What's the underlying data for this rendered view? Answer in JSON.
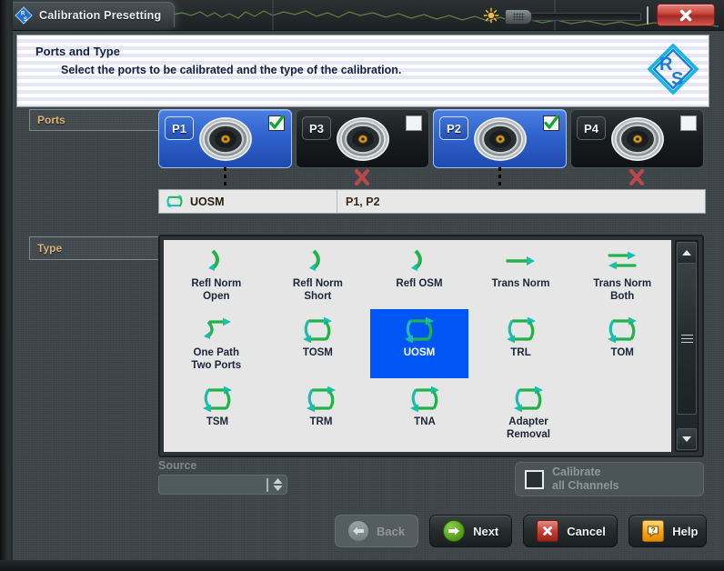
{
  "titlebar": {
    "tab_title": "Calibration Presetting",
    "logo_icon": "rohde-schwarz-logo-icon",
    "brightness_icon": "sun-brightness-icon",
    "slider_value": 0,
    "close_label": "X",
    "close_icon": "close-icon"
  },
  "header": {
    "title": "Ports and Type",
    "subtitle": "Select the ports to be calibrated and the type of the calibration.",
    "logo_icon": "rs-diamond-logo-icon",
    "logo_letters": [
      "R",
      "S"
    ]
  },
  "ports": {
    "label": "Ports",
    "items": [
      {
        "name": "P1",
        "selected": true,
        "checked": true,
        "marker": "dots"
      },
      {
        "name": "P3",
        "selected": false,
        "checked": false,
        "marker": "cross"
      },
      {
        "name": "P2",
        "selected": true,
        "checked": true,
        "marker": "dots"
      },
      {
        "name": "P4",
        "selected": false,
        "checked": false,
        "marker": "cross"
      }
    ]
  },
  "summary": {
    "icon": "uosm-loop-icon",
    "cal_type": "UOSM",
    "cal_ports": "P1, P2"
  },
  "type": {
    "label": "Type",
    "selected": "UOSM",
    "rows": [
      [
        {
          "label": "Refl Norm\nOpen",
          "icon": "reflection-arrow-icon",
          "selected": false
        },
        {
          "label": "Refl Norm\nShort",
          "icon": "reflection-arrow-icon",
          "selected": false
        },
        {
          "label": "Refl OSM",
          "icon": "reflection-arrow-icon",
          "selected": false
        },
        {
          "label": "Trans Norm",
          "icon": "right-arrow-icon",
          "selected": false
        },
        {
          "label": "Trans Norm\nBoth",
          "icon": "double-arrow-icon",
          "selected": false
        }
      ],
      [
        {
          "label": "One Path\nTwo Ports",
          "icon": "one-path-arrow-icon",
          "selected": false
        },
        {
          "label": "TOSM",
          "icon": "loop-arrow-icon",
          "selected": false
        },
        {
          "label": "UOSM",
          "icon": "loop-arrow-icon",
          "selected": true
        },
        {
          "label": "TRL",
          "icon": "loop-arrow-icon",
          "selected": false
        },
        {
          "label": "TOM",
          "icon": "loop-arrow-icon",
          "selected": false
        }
      ],
      [
        {
          "label": "TSM",
          "icon": "loop-arrow-icon",
          "selected": false
        },
        {
          "label": "TRM",
          "icon": "loop-arrow-icon",
          "selected": false
        },
        {
          "label": "TNA",
          "icon": "loop-arrow-icon",
          "selected": false
        },
        {
          "label": "Adapter\nRemoval",
          "icon": "loop-arrow-icon",
          "selected": false
        }
      ]
    ],
    "scrollbar": {
      "up_icon": "triangle-up-icon",
      "down_icon": "triangle-down-icon",
      "grip_icon": "grip-lines-icon"
    }
  },
  "source": {
    "label": "Source",
    "value": "",
    "placeholder": "",
    "disabled": true,
    "spinner_icon": "spinner-updown-icon"
  },
  "calibrate_all": {
    "label_line1": "Calibrate",
    "label_line2": "all Channels",
    "checked": false
  },
  "buttons": [
    {
      "label": "Back",
      "icon": "arrow-left-circle-icon",
      "disabled": true
    },
    {
      "label": "Next",
      "icon": "arrow-right-circle-icon",
      "disabled": false
    },
    {
      "label": "Cancel",
      "icon": "x-square-icon",
      "disabled": false
    },
    {
      "label": "Help",
      "icon": "question-bubble-icon",
      "disabled": false
    }
  ],
  "colors": {
    "accent_blue": "#0055f5",
    "port_selected": "#2f63cf",
    "icon_green": "#22b24c",
    "icon_teal": "#18bfae",
    "close_red": "#c9453c",
    "label_gold": "#d8b37a",
    "next_green": "#4f9b18",
    "help_orange": "#f5a623"
  }
}
